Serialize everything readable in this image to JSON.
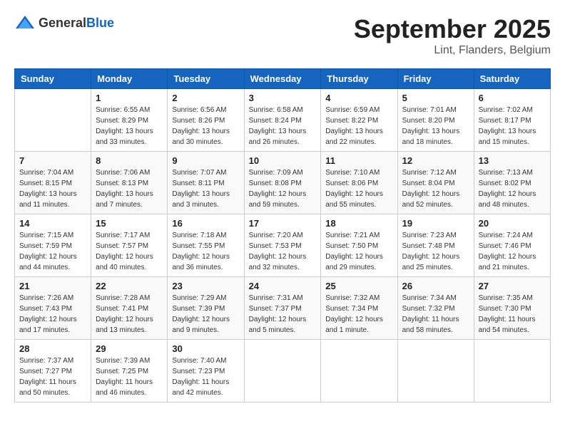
{
  "header": {
    "logo_general": "General",
    "logo_blue": "Blue",
    "month_title": "September 2025",
    "location": "Lint, Flanders, Belgium"
  },
  "columns": [
    "Sunday",
    "Monday",
    "Tuesday",
    "Wednesday",
    "Thursday",
    "Friday",
    "Saturday"
  ],
  "weeks": [
    [
      {
        "day": "",
        "info": ""
      },
      {
        "day": "1",
        "info": "Sunrise: 6:55 AM\nSunset: 8:29 PM\nDaylight: 13 hours\nand 33 minutes."
      },
      {
        "day": "2",
        "info": "Sunrise: 6:56 AM\nSunset: 8:26 PM\nDaylight: 13 hours\nand 30 minutes."
      },
      {
        "day": "3",
        "info": "Sunrise: 6:58 AM\nSunset: 8:24 PM\nDaylight: 13 hours\nand 26 minutes."
      },
      {
        "day": "4",
        "info": "Sunrise: 6:59 AM\nSunset: 8:22 PM\nDaylight: 13 hours\nand 22 minutes."
      },
      {
        "day": "5",
        "info": "Sunrise: 7:01 AM\nSunset: 8:20 PM\nDaylight: 13 hours\nand 18 minutes."
      },
      {
        "day": "6",
        "info": "Sunrise: 7:02 AM\nSunset: 8:17 PM\nDaylight: 13 hours\nand 15 minutes."
      }
    ],
    [
      {
        "day": "7",
        "info": "Sunrise: 7:04 AM\nSunset: 8:15 PM\nDaylight: 13 hours\nand 11 minutes."
      },
      {
        "day": "8",
        "info": "Sunrise: 7:06 AM\nSunset: 8:13 PM\nDaylight: 13 hours\nand 7 minutes."
      },
      {
        "day": "9",
        "info": "Sunrise: 7:07 AM\nSunset: 8:11 PM\nDaylight: 13 hours\nand 3 minutes."
      },
      {
        "day": "10",
        "info": "Sunrise: 7:09 AM\nSunset: 8:08 PM\nDaylight: 12 hours\nand 59 minutes."
      },
      {
        "day": "11",
        "info": "Sunrise: 7:10 AM\nSunset: 8:06 PM\nDaylight: 12 hours\nand 55 minutes."
      },
      {
        "day": "12",
        "info": "Sunrise: 7:12 AM\nSunset: 8:04 PM\nDaylight: 12 hours\nand 52 minutes."
      },
      {
        "day": "13",
        "info": "Sunrise: 7:13 AM\nSunset: 8:02 PM\nDaylight: 12 hours\nand 48 minutes."
      }
    ],
    [
      {
        "day": "14",
        "info": "Sunrise: 7:15 AM\nSunset: 7:59 PM\nDaylight: 12 hours\nand 44 minutes."
      },
      {
        "day": "15",
        "info": "Sunrise: 7:17 AM\nSunset: 7:57 PM\nDaylight: 12 hours\nand 40 minutes."
      },
      {
        "day": "16",
        "info": "Sunrise: 7:18 AM\nSunset: 7:55 PM\nDaylight: 12 hours\nand 36 minutes."
      },
      {
        "day": "17",
        "info": "Sunrise: 7:20 AM\nSunset: 7:53 PM\nDaylight: 12 hours\nand 32 minutes."
      },
      {
        "day": "18",
        "info": "Sunrise: 7:21 AM\nSunset: 7:50 PM\nDaylight: 12 hours\nand 29 minutes."
      },
      {
        "day": "19",
        "info": "Sunrise: 7:23 AM\nSunset: 7:48 PM\nDaylight: 12 hours\nand 25 minutes."
      },
      {
        "day": "20",
        "info": "Sunrise: 7:24 AM\nSunset: 7:46 PM\nDaylight: 12 hours\nand 21 minutes."
      }
    ],
    [
      {
        "day": "21",
        "info": "Sunrise: 7:26 AM\nSunset: 7:43 PM\nDaylight: 12 hours\nand 17 minutes."
      },
      {
        "day": "22",
        "info": "Sunrise: 7:28 AM\nSunset: 7:41 PM\nDaylight: 12 hours\nand 13 minutes."
      },
      {
        "day": "23",
        "info": "Sunrise: 7:29 AM\nSunset: 7:39 PM\nDaylight: 12 hours\nand 9 minutes."
      },
      {
        "day": "24",
        "info": "Sunrise: 7:31 AM\nSunset: 7:37 PM\nDaylight: 12 hours\nand 5 minutes."
      },
      {
        "day": "25",
        "info": "Sunrise: 7:32 AM\nSunset: 7:34 PM\nDaylight: 12 hours\nand 1 minute."
      },
      {
        "day": "26",
        "info": "Sunrise: 7:34 AM\nSunset: 7:32 PM\nDaylight: 11 hours\nand 58 minutes."
      },
      {
        "day": "27",
        "info": "Sunrise: 7:35 AM\nSunset: 7:30 PM\nDaylight: 11 hours\nand 54 minutes."
      }
    ],
    [
      {
        "day": "28",
        "info": "Sunrise: 7:37 AM\nSunset: 7:27 PM\nDaylight: 11 hours\nand 50 minutes."
      },
      {
        "day": "29",
        "info": "Sunrise: 7:39 AM\nSunset: 7:25 PM\nDaylight: 11 hours\nand 46 minutes."
      },
      {
        "day": "30",
        "info": "Sunrise: 7:40 AM\nSunset: 7:23 PM\nDaylight: 11 hours\nand 42 minutes."
      },
      {
        "day": "",
        "info": ""
      },
      {
        "day": "",
        "info": ""
      },
      {
        "day": "",
        "info": ""
      },
      {
        "day": "",
        "info": ""
      }
    ]
  ]
}
